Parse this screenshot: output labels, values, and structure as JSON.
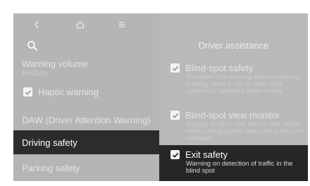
{
  "topbar": {
    "back_icon": "chevron-left-icon",
    "home_icon": "home-icon",
    "menu_icon": "menu-icon"
  },
  "sidebar": {
    "search_icon": "search-icon",
    "warning_volume": {
      "label": "Warning volume",
      "value": "Medium"
    },
    "haptic_warning": {
      "label": "Haptic warning",
      "checked": true
    },
    "items": [
      {
        "label": "DAW (Driver Attention Warning)",
        "selected": false
      },
      {
        "label": "Driving safety",
        "selected": true
      },
      {
        "label": "Parking safety",
        "selected": false
      }
    ]
  },
  "panel": {
    "title": "Driver assistance",
    "options": [
      {
        "label": "Blind-spot safety",
        "checked": true,
        "description": "Provision of a warning and emergency braking when a risk of blind-spot collision is detected while exiting"
      },
      {
        "label": "Blind-spot view monitor",
        "checked": true,
        "description": "Display of blind-spot view in the cluster when changing the lanes using the turn indicator"
      },
      {
        "label": "Exit safety",
        "checked": true,
        "description": "Warning on detection of traffic in the blind spot"
      }
    ]
  },
  "colors": {
    "background": "#b9b9b9",
    "selected_row": "#2c2c2c",
    "text_primary": "#ffffff"
  }
}
